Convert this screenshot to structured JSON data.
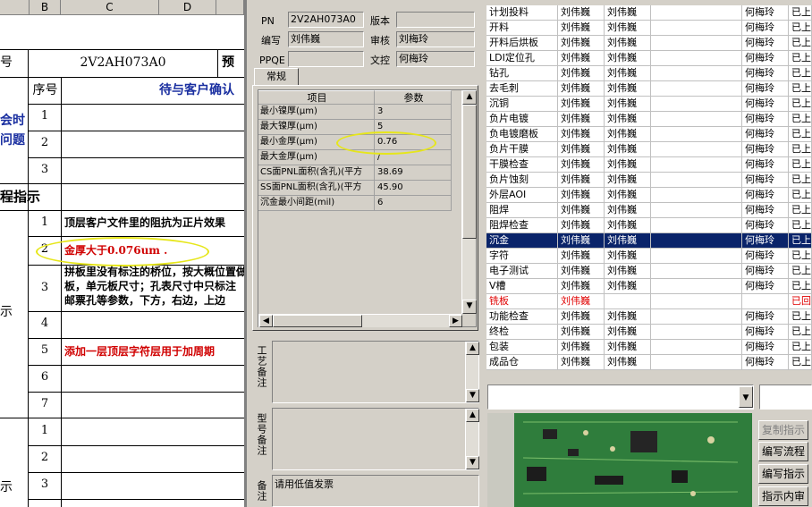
{
  "sheet": {
    "columns": [
      "B",
      "C",
      "D"
    ],
    "part_number": "2V2AH073A0",
    "header_left_partial": "号",
    "header_right_partial": "预",
    "seq_header": "序号",
    "pending_title": "待与客户确认",
    "side_label_1": "会时\n问题",
    "section_label": "程指示",
    "side_label_2": "示",
    "side_label_3": "示",
    "rows_top": [
      "1",
      "2",
      "3"
    ],
    "rows_mid": [
      {
        "num": "1",
        "text": "顶层客户文件里的阻抗为正片效果"
      },
      {
        "num": "2",
        "text": "金厚大于0.076um ."
      },
      {
        "num": "3",
        "text": "拼板里没有标注的桥位，按大概位置做，\n板，单元板尺寸；孔表尺寸中只标注\n邮票孔等参数，下方，右边，上边"
      },
      {
        "num": "4",
        "text": ""
      },
      {
        "num": "5",
        "text": "添加一层顶层字符层用于加周期"
      },
      {
        "num": "6",
        "text": ""
      },
      {
        "num": "7",
        "text": ""
      }
    ],
    "rows_bottom": [
      "1",
      "2",
      "3"
    ]
  },
  "mid": {
    "pn_label": "PN",
    "pn_value": "2V2AH073A0",
    "version_label": "版本",
    "version_value": "",
    "author_label": "编写",
    "author_value": "刘伟巍",
    "reviewer_label": "审核",
    "reviewer_value": "刘梅玲",
    "ppqe_label": "PPQE",
    "ppqe_value": "",
    "doc_control_label": "文控",
    "doc_control_value": "何梅玲",
    "tab_label": "常规",
    "table_headers": [
      "项目",
      "参数"
    ],
    "table_rows": [
      {
        "item": "最小镍厚(μm)",
        "value": "3"
      },
      {
        "item": "最大镍厚(μm)",
        "value": "5"
      },
      {
        "item": "最小金厚(μm)",
        "value": "0.76"
      },
      {
        "item": "最大金厚(μm)",
        "value": "/"
      },
      {
        "item": "CS面PNL面积(含孔)(平方",
        "value": "38.69"
      },
      {
        "item": "SS面PNL面积(含孔)(平方",
        "value": "45.90"
      },
      {
        "item": "沉金最小间距(mil)",
        "value": "6"
      }
    ],
    "process_note_label": "工艺备注",
    "model_note_label": "型号备注",
    "order_note_label": "订单备注",
    "order_note_value": "请用低值发票"
  },
  "right": {
    "rows": [
      {
        "step": "计划投料",
        "c1": "刘伟巍",
        "c2": "刘伟巍",
        "c3": "",
        "c4": "何梅玲",
        "c5": "已上"
      },
      {
        "step": "开料",
        "c1": "刘伟巍",
        "c2": "刘伟巍",
        "c3": "",
        "c4": "何梅玲",
        "c5": "已上"
      },
      {
        "step": "开料后烘板",
        "c1": "刘伟巍",
        "c2": "刘伟巍",
        "c3": "",
        "c4": "何梅玲",
        "c5": "已上"
      },
      {
        "step": "LDI定位孔",
        "c1": "刘伟巍",
        "c2": "刘伟巍",
        "c3": "",
        "c4": "何梅玲",
        "c5": "已上"
      },
      {
        "step": "钻孔",
        "c1": "刘伟巍",
        "c2": "刘伟巍",
        "c3": "",
        "c4": "何梅玲",
        "c5": "已上"
      },
      {
        "step": "去毛刺",
        "c1": "刘伟巍",
        "c2": "刘伟巍",
        "c3": "",
        "c4": "何梅玲",
        "c5": "已上"
      },
      {
        "step": "沉铜",
        "c1": "刘伟巍",
        "c2": "刘伟巍",
        "c3": "",
        "c4": "何梅玲",
        "c5": "已上"
      },
      {
        "step": "负片电镀",
        "c1": "刘伟巍",
        "c2": "刘伟巍",
        "c3": "",
        "c4": "何梅玲",
        "c5": "已上"
      },
      {
        "step": "负电镀磨板",
        "c1": "刘伟巍",
        "c2": "刘伟巍",
        "c3": "",
        "c4": "何梅玲",
        "c5": "已上"
      },
      {
        "step": "负片干膜",
        "c1": "刘伟巍",
        "c2": "刘伟巍",
        "c3": "",
        "c4": "何梅玲",
        "c5": "已上"
      },
      {
        "step": "干膜检查",
        "c1": "刘伟巍",
        "c2": "刘伟巍",
        "c3": "",
        "c4": "何梅玲",
        "c5": "已上"
      },
      {
        "step": "负片蚀刻",
        "c1": "刘伟巍",
        "c2": "刘伟巍",
        "c3": "",
        "c4": "何梅玲",
        "c5": "已上"
      },
      {
        "step": "外层AOI",
        "c1": "刘伟巍",
        "c2": "刘伟巍",
        "c3": "",
        "c4": "何梅玲",
        "c5": "已上"
      },
      {
        "step": "阻焊",
        "c1": "刘伟巍",
        "c2": "刘伟巍",
        "c3": "",
        "c4": "何梅玲",
        "c5": "已上"
      },
      {
        "step": "阻焊检查",
        "c1": "刘伟巍",
        "c2": "刘伟巍",
        "c3": "",
        "c4": "何梅玲",
        "c5": "已上"
      },
      {
        "step": "沉金",
        "c1": "刘伟巍",
        "c2": "刘伟巍",
        "c3": "",
        "c4": "何梅玲",
        "c5": "已上"
      },
      {
        "step": "字符",
        "c1": "刘伟巍",
        "c2": "刘伟巍",
        "c3": "",
        "c4": "何梅玲",
        "c5": "已上"
      },
      {
        "step": "电子测试",
        "c1": "刘伟巍",
        "c2": "刘伟巍",
        "c3": "",
        "c4": "何梅玲",
        "c5": "已上"
      },
      {
        "step": "V槽",
        "c1": "刘伟巍",
        "c2": "刘伟巍",
        "c3": "",
        "c4": "何梅玲",
        "c5": "已上"
      },
      {
        "step": "铣板",
        "c1": "刘伟巍",
        "c2": "",
        "c3": "",
        "c4": "",
        "c5": "已回"
      },
      {
        "step": "功能检查",
        "c1": "刘伟巍",
        "c2": "刘伟巍",
        "c3": "",
        "c4": "何梅玲",
        "c5": "已上"
      },
      {
        "step": "终检",
        "c1": "刘伟巍",
        "c2": "刘伟巍",
        "c3": "",
        "c4": "何梅玲",
        "c5": "已上"
      },
      {
        "step": "包装",
        "c1": "刘伟巍",
        "c2": "刘伟巍",
        "c3": "",
        "c4": "何梅玲",
        "c5": "已上"
      },
      {
        "step": "成品仓",
        "c1": "刘伟巍",
        "c2": "刘伟巍",
        "c3": "",
        "c4": "何梅玲",
        "c5": "已上"
      }
    ],
    "selected_step": "沉金",
    "error_step": "铣板",
    "buttons": {
      "copy": "复制指示",
      "edit_flow": "编写流程",
      "edit_instructions": "编写指示",
      "instruction_review": "指示内审"
    },
    "combo_left_value": "",
    "combo_right_value": ""
  }
}
